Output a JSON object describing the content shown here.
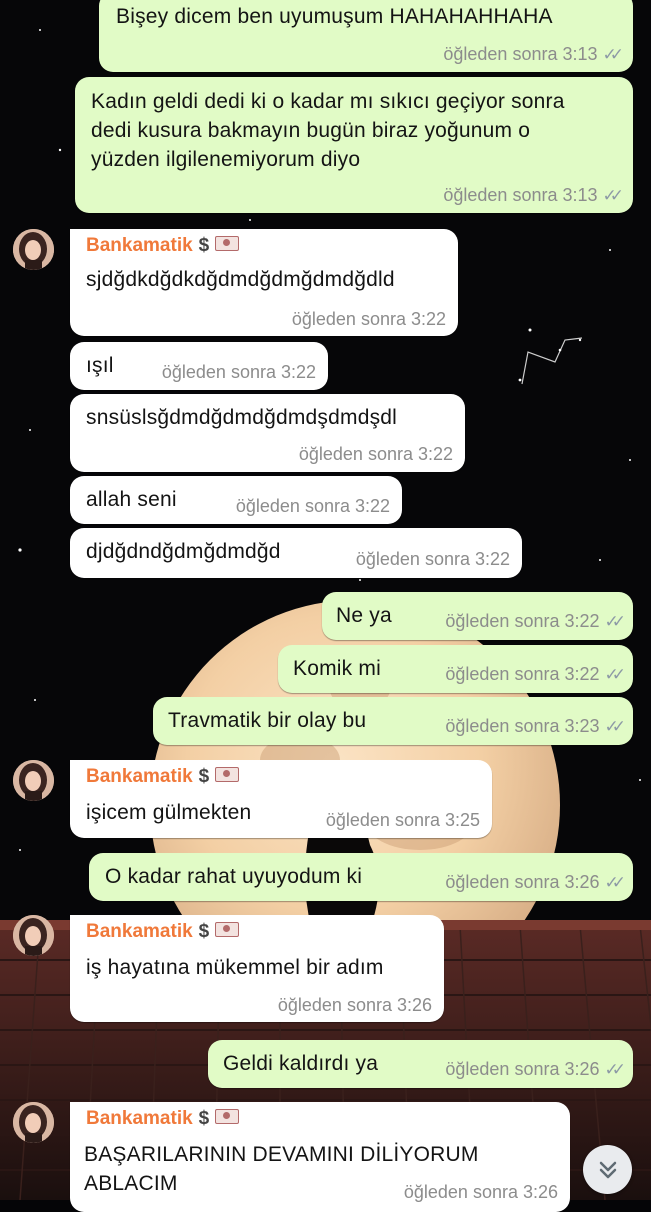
{
  "contact": {
    "name": "Bankamatik",
    "dollar": "$",
    "name_color": "#f0793a"
  },
  "colors": {
    "outgoing_bubble": "#e1fbc6",
    "incoming_bubble": "#ffffff",
    "timestamp": "#8c8c8c",
    "ticks": "#8d9aa6"
  },
  "messages": [
    {
      "dir": "out",
      "text": "Bişey dicem ben uyumuşum HAHAHAHHAHA",
      "time": "öğleden sonra 3:13",
      "status": "read"
    },
    {
      "dir": "out",
      "text": "Kadın geldi dedi ki o kadar mı sıkıcı geçiyor sonra dedi kusura bakmayın bugün biraz yoğunum o yüzden ilgilenemiyorum diyo",
      "time": "öğleden sonra 3:13",
      "status": "read"
    },
    {
      "dir": "in",
      "text": "sjdğdkdğdkdğdmdğdmğdmdğdld",
      "time": "öğleden sonra 3:22"
    },
    {
      "dir": "in",
      "text": "ışıl",
      "time": "öğleden sonra 3:22"
    },
    {
      "dir": "in",
      "text": "snsüslsğdmdğdmdğdmdşdmdşdl",
      "time": "öğleden sonra 3:22"
    },
    {
      "dir": "in",
      "text": "allah seni",
      "time": "öğleden sonra 3:22"
    },
    {
      "dir": "in",
      "text": "djdğdndğdmğdmdğd",
      "time": "öğleden sonra 3:22"
    },
    {
      "dir": "out",
      "text": "Ne ya",
      "time": "öğleden sonra 3:22",
      "status": "read"
    },
    {
      "dir": "out",
      "text": "Komik mi",
      "time": "öğleden sonra 3:22",
      "status": "read"
    },
    {
      "dir": "out",
      "text": "Travmatik bir olay bu",
      "time": "öğleden sonra 3:23",
      "status": "read"
    },
    {
      "dir": "in",
      "text": "işicem gülmekten",
      "time": "öğleden sonra 3:25"
    },
    {
      "dir": "out",
      "text": "O kadar rahat uyuyodum ki",
      "time": "öğleden sonra 3:26",
      "status": "read"
    },
    {
      "dir": "in",
      "text": "iş hayatına mükemmel bir adım",
      "time": "öğleden sonra 3:26"
    },
    {
      "dir": "out",
      "text": "Geldi kaldırdı ya",
      "time": "öğleden sonra 3:26",
      "status": "read"
    },
    {
      "dir": "in",
      "text": "BAŞARILARININ DEVAMINI DİLİYORUM ABLACIM",
      "time": "öğleden sonra 3:26"
    }
  ],
  "icons": {
    "read_ticks": "double-check-icon",
    "scroll_down": "double-chevron-down-icon",
    "sender_badge": "banknote-icon"
  }
}
